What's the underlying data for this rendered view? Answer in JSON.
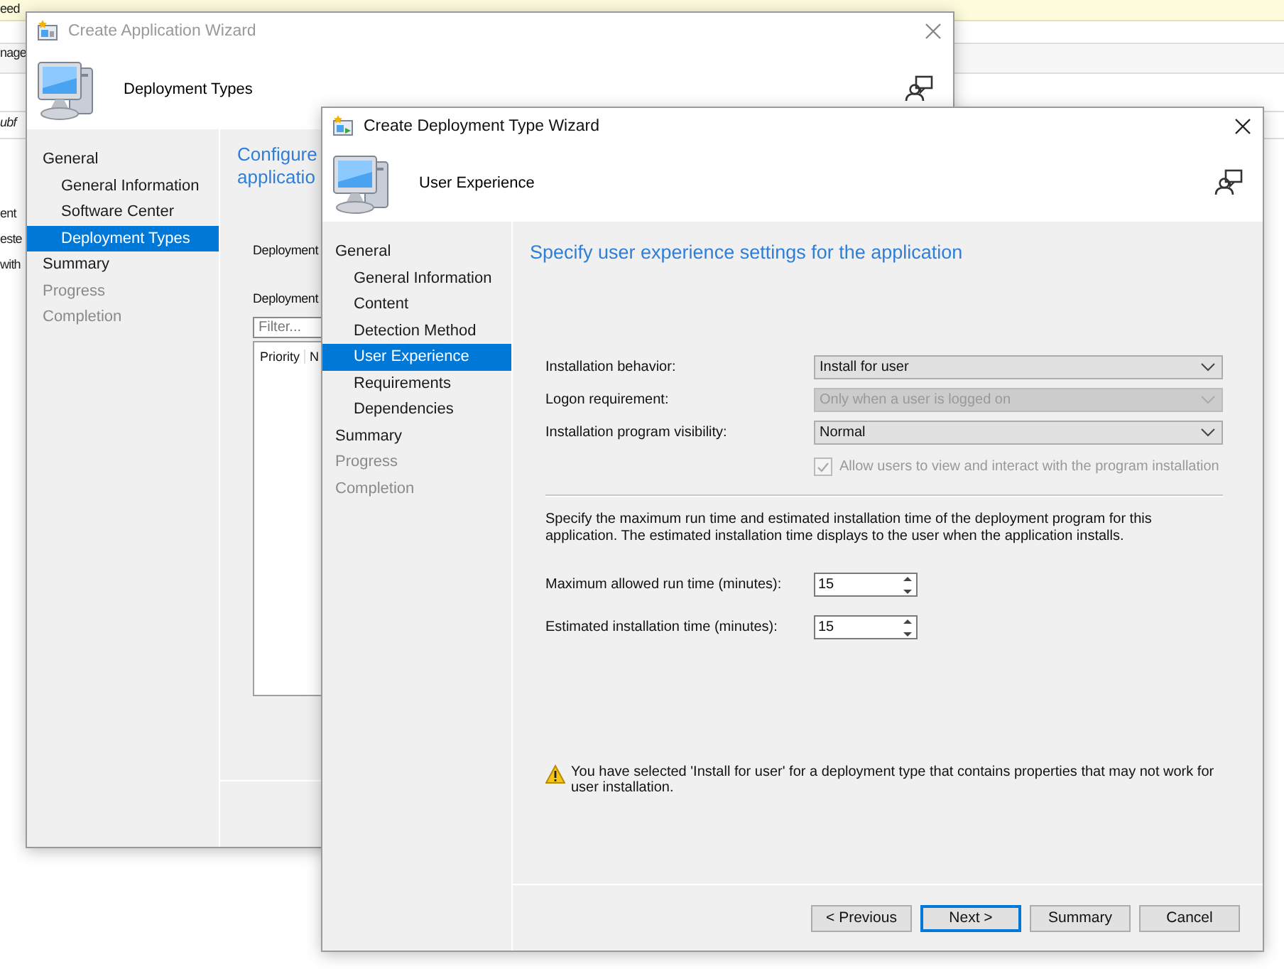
{
  "background": {
    "fragments": [
      {
        "text": "eed"
      },
      {
        "text": "nage"
      },
      {
        "text": "ubf"
      },
      {
        "text": "ent"
      },
      {
        "text": "este"
      },
      {
        "text": "with"
      }
    ]
  },
  "application_wizard": {
    "title": "Create Application Wizard",
    "header": "Deployment Types",
    "active": false,
    "nav": [
      {
        "label": "General",
        "selected": false,
        "disabled": false,
        "children": [
          {
            "label": "General Information",
            "selected": false,
            "disabled": false
          },
          {
            "label": "Software Center",
            "selected": false,
            "disabled": false
          },
          {
            "label": "Deployment Types",
            "selected": true,
            "disabled": false
          }
        ]
      },
      {
        "label": "Summary",
        "selected": false,
        "disabled": false
      },
      {
        "label": "Progress",
        "selected": false,
        "disabled": true
      },
      {
        "label": "Completion",
        "selected": false,
        "disabled": true
      }
    ],
    "heading_lines": [
      "Configure",
      "applicatio"
    ],
    "labels": [
      "Deployment",
      "Deployment"
    ],
    "filter": {
      "placeholder": "Filter..."
    },
    "columns": [
      "Priority",
      "N"
    ]
  },
  "deployment_type_wizard": {
    "title": "Create Deployment Type Wizard",
    "header": "User Experience",
    "active": true,
    "nav": [
      {
        "label": "General",
        "selected": false,
        "disabled": false,
        "children": [
          {
            "label": "General Information",
            "selected": false,
            "disabled": false
          },
          {
            "label": "Content",
            "selected": false,
            "disabled": false
          },
          {
            "label": "Detection Method",
            "selected": false,
            "disabled": false
          },
          {
            "label": "User Experience",
            "selected": true,
            "disabled": false
          },
          {
            "label": "Requirements",
            "selected": false,
            "disabled": false
          },
          {
            "label": "Dependencies",
            "selected": false,
            "disabled": false
          }
        ]
      },
      {
        "label": "Summary",
        "selected": false,
        "disabled": false
      },
      {
        "label": "Progress",
        "selected": false,
        "disabled": true
      },
      {
        "label": "Completion",
        "selected": false,
        "disabled": true
      }
    ],
    "heading": "Specify user experience settings for the application",
    "fields": [
      {
        "label": "Installation behavior:",
        "value": "Install for user",
        "disabled": false
      },
      {
        "label": "Logon requirement:",
        "value": "Only when a user is logged on",
        "disabled": true
      },
      {
        "label": "Installation program visibility:",
        "value": "Normal",
        "disabled": false
      }
    ],
    "checkbox": {
      "label": "Allow users to view and interact with the program installation",
      "checked": true,
      "disabled": true
    },
    "description": "Specify the maximum run time and estimated installation time of the deployment program for this application. The estimated installation time displays to the user when the application installs.",
    "spinners": [
      {
        "label": "Maximum allowed run time (minutes):",
        "value": "15"
      },
      {
        "label": "Estimated installation time (minutes):",
        "value": "15"
      }
    ],
    "warning": "You have selected 'Install for user' for a deployment type that contains properties that may not work for user installation.",
    "buttons": [
      {
        "label": "< Previous",
        "default": false
      },
      {
        "label": "Next >",
        "default": true
      },
      {
        "label": "Summary",
        "default": false
      },
      {
        "label": "Cancel",
        "default": false
      }
    ]
  }
}
